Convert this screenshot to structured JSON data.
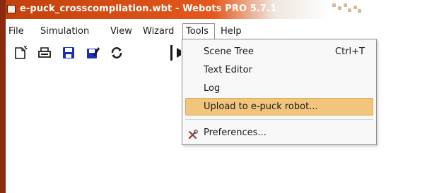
{
  "window": {
    "title": "e-puck_crosscompilation.wbt - Webots PRO 5.7.1"
  },
  "menubar": {
    "items": [
      {
        "label": "File"
      },
      {
        "label": "Simulation"
      },
      {
        "label": "View"
      },
      {
        "label": "Wizard"
      },
      {
        "label": "Tools"
      },
      {
        "label": "Help"
      }
    ]
  },
  "toolbar": {
    "buttons": [
      {
        "icon": "new-file-icon"
      },
      {
        "icon": "open-file-icon"
      },
      {
        "icon": "save-icon"
      },
      {
        "icon": "save-as-icon"
      },
      {
        "icon": "revert-icon"
      },
      {
        "icon": "play-icon"
      }
    ]
  },
  "tools_menu": {
    "items": [
      {
        "label": "Scene Tree",
        "shortcut": "Ctrl+T"
      },
      {
        "label": "Text Editor"
      },
      {
        "label": "Log"
      },
      {
        "label": "Upload to e-puck robot...",
        "highlighted": true
      },
      {
        "label": "Preferences...",
        "icon": "preferences-tools-icon"
      }
    ]
  },
  "colors": {
    "title_bar": "#e4581c",
    "highlight": "#f2c57c",
    "toolbar_blue": "#1c2fb0"
  }
}
